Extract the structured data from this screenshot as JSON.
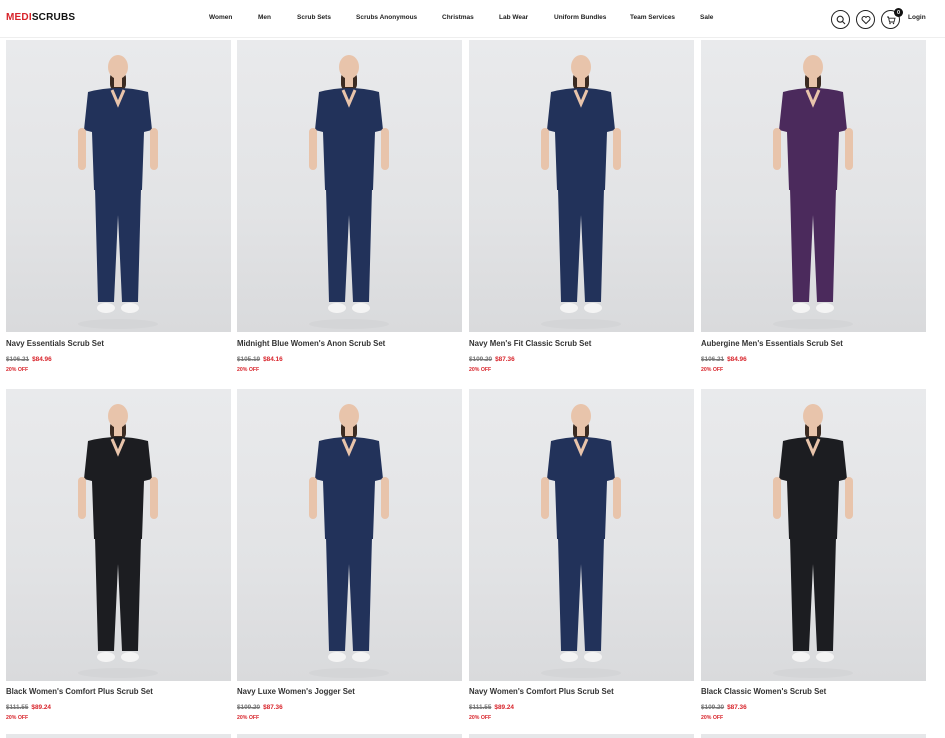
{
  "brand": {
    "part1": "MEDI",
    "part2": "SCRUBS"
  },
  "nav": [
    "Women",
    "Men",
    "Scrub Sets",
    "Scrubs Anonymous",
    "Christmas",
    "Lab Wear",
    "Uniform Bundles",
    "Team Services",
    "Sale"
  ],
  "header": {
    "cart_count": "0",
    "login_label": "Login",
    "icons": [
      "search-icon",
      "heart-icon",
      "cart-icon"
    ]
  },
  "colors": {
    "brand_red": "#d8232a",
    "navy": "#22325a",
    "black": "#1c1d21",
    "aubergine": "#4b2a5c"
  },
  "products": [
    {
      "name": "Navy Essentials Scrub Set",
      "old_price": "$106.21",
      "price": "$84.96",
      "discount": "20% OFF",
      "color": "navy"
    },
    {
      "name": "Midnight Blue Women's Anon Scrub Set",
      "old_price": "$105.19",
      "price": "$84.16",
      "discount": "20% OFF",
      "color": "navy"
    },
    {
      "name": "Navy Men's Fit Classic Scrub Set",
      "old_price": "$109.20",
      "price": "$87.36",
      "discount": "20% OFF",
      "color": "navy"
    },
    {
      "name": "Aubergine Men's Essentials Scrub Set",
      "old_price": "$106.21",
      "price": "$84.96",
      "discount": "20% OFF",
      "color": "aubergine"
    },
    {
      "name": "Black Women's Comfort Plus Scrub Set",
      "old_price": "$111.55",
      "price": "$89.24",
      "discount": "20% OFF",
      "color": "black"
    },
    {
      "name": "Navy Luxe Women's Jogger Set",
      "old_price": "$109.20",
      "price": "$87.36",
      "discount": "20% OFF",
      "color": "navy"
    },
    {
      "name": "Navy Women's Comfort Plus Scrub Set",
      "old_price": "$111.55",
      "price": "$89.24",
      "discount": "20% OFF",
      "color": "navy"
    },
    {
      "name": "Black Classic Women's Scrub Set",
      "old_price": "$109.20",
      "price": "$87.36",
      "discount": "20% OFF",
      "color": "black"
    }
  ]
}
